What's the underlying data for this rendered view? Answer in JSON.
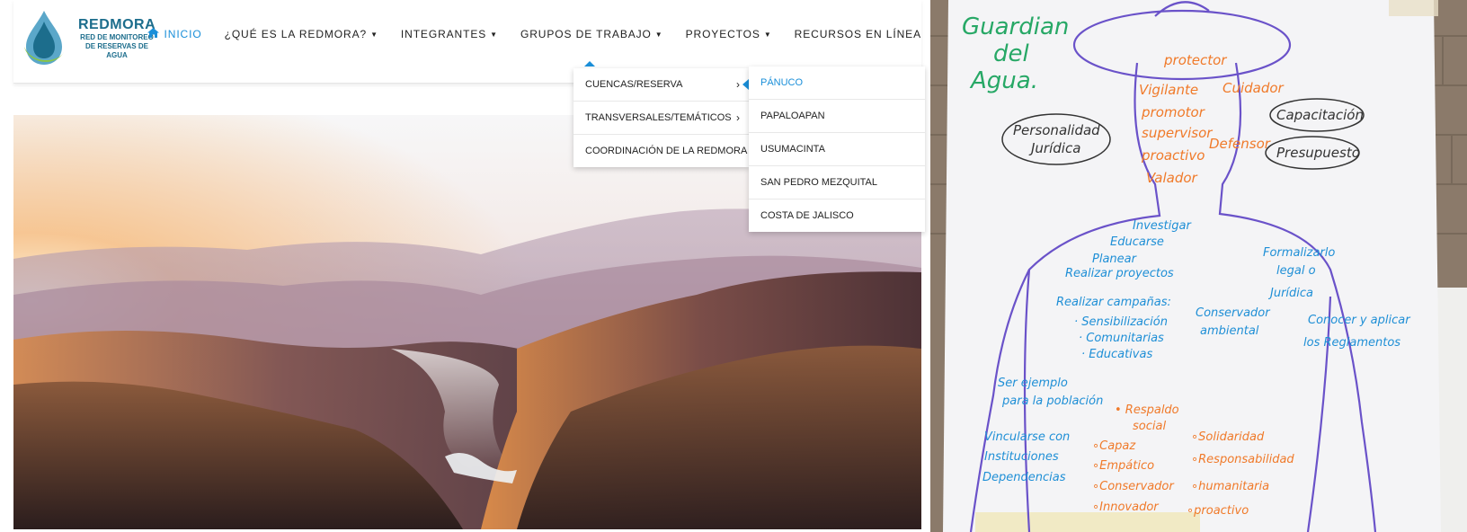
{
  "header": {
    "logo": {
      "name": "REDMORA",
      "subtitle_line1": "RED DE MONITOREO",
      "subtitle_line2": "DE RESERVAS DE AGUA"
    },
    "nav": [
      {
        "label": "INICIO",
        "icon": "home-icon",
        "active": true
      },
      {
        "label": "¿QUÉ ES LA REDMORA?",
        "caret": true
      },
      {
        "label": "INTEGRANTES",
        "caret": true
      },
      {
        "label": "GRUPOS DE TRABAJO",
        "caret": true
      },
      {
        "label": "PROYECTOS",
        "caret": true
      },
      {
        "label": "RECURSOS EN LÍNEA"
      }
    ]
  },
  "dropdown": {
    "items": [
      {
        "label": "CUENCAS/RESERVA"
      },
      {
        "label": "TRANSVERSALES/TEMÁTICOS"
      },
      {
        "label": "COORDINACIÓN DE LA REDMORA"
      }
    ]
  },
  "submenu": {
    "items": [
      {
        "label": "PÁNUCO",
        "active": true
      },
      {
        "label": "PAPALOAPAN"
      },
      {
        "label": "USUMACINTA"
      },
      {
        "label": "SAN PEDRO MEZQUITAL"
      },
      {
        "label": "COSTA DE JALISCO"
      }
    ]
  },
  "poster": {
    "title_line1": "Guardian",
    "title_line2": "del",
    "title_line3": "Agua.",
    "cloud_left_line1": "Personalidad",
    "cloud_left_line2": "Jurídica",
    "cloud_right_top": "Capacitación",
    "cloud_right_bottom": "Presupuesto",
    "hat_word": "protector",
    "head_words": [
      "Vigilante",
      "Cuidador",
      "promotor",
      "supervisor",
      "Defensor",
      "proactivo",
      "Valador"
    ],
    "blue_words": [
      "Investigar",
      "Educarse",
      "Planear",
      "Realizar proyectos",
      "Realizar campañas:",
      "· Sensibilización",
      "· Comunitarias",
      "· Educativas",
      "Conservador",
      "ambiental",
      "Formalizarlo",
      "legal o",
      "Jurídica",
      "Ser ejemplo",
      "para la población",
      "Vincularse con",
      "Instituciones",
      "Dependencias",
      "Conocer y aplicar",
      "los Reglamentos"
    ],
    "orange_words": [
      "• Respaldo",
      "social",
      "∘Capaz",
      "∘Empático",
      "∘Conservador",
      "∘Innovador",
      "∘Solidaridad",
      "∘Responsabilidad",
      "∘humanitaria",
      "∘proactivo"
    ]
  },
  "colors": {
    "accent": "#1a8fd9",
    "brand": "#1c6d8c",
    "marker_blue": "#1f8fd6",
    "marker_orange": "#f07a2a",
    "marker_green": "#27a866",
    "marker_purple": "#6a52c9"
  }
}
